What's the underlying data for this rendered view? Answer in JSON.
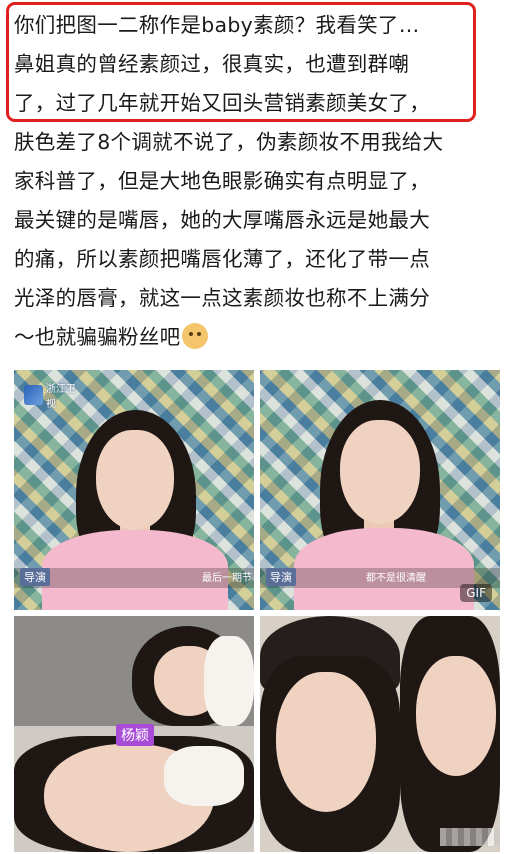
{
  "post": {
    "lines": [
      "你们把图一二称作是baby素颜？我看笑了…",
      "鼻姐真的曾经素颜过，很真实，也遭到群嘲",
      "了，过了几年就开始又回头营销素颜美女了，",
      "肤色差了8个调就不说了，伪素颜妆不用我给大",
      "家科普了，但是大地色眼影确实有点明显了，",
      "最关键的是嘴唇，她的大厚嘴唇永远是她最大",
      "的痛，所以素颜把嘴唇化薄了，还化了带一点",
      "光泽的唇膏，就这一点这素颜妆也称不上满分",
      "～也就骗骗粉丝吧"
    ],
    "emoji": "doge-emoji",
    "highlight_color": "#e0201e"
  },
  "images": {
    "p1": {
      "logo_text": "浙江卫视",
      "badge": "导演",
      "subtitle": "最后一期节"
    },
    "p2": {
      "badge": "导演",
      "subtitle": "都不是很清醒",
      "gif": "GIF"
    },
    "p3": {
      "name_tag": "杨颖"
    }
  }
}
